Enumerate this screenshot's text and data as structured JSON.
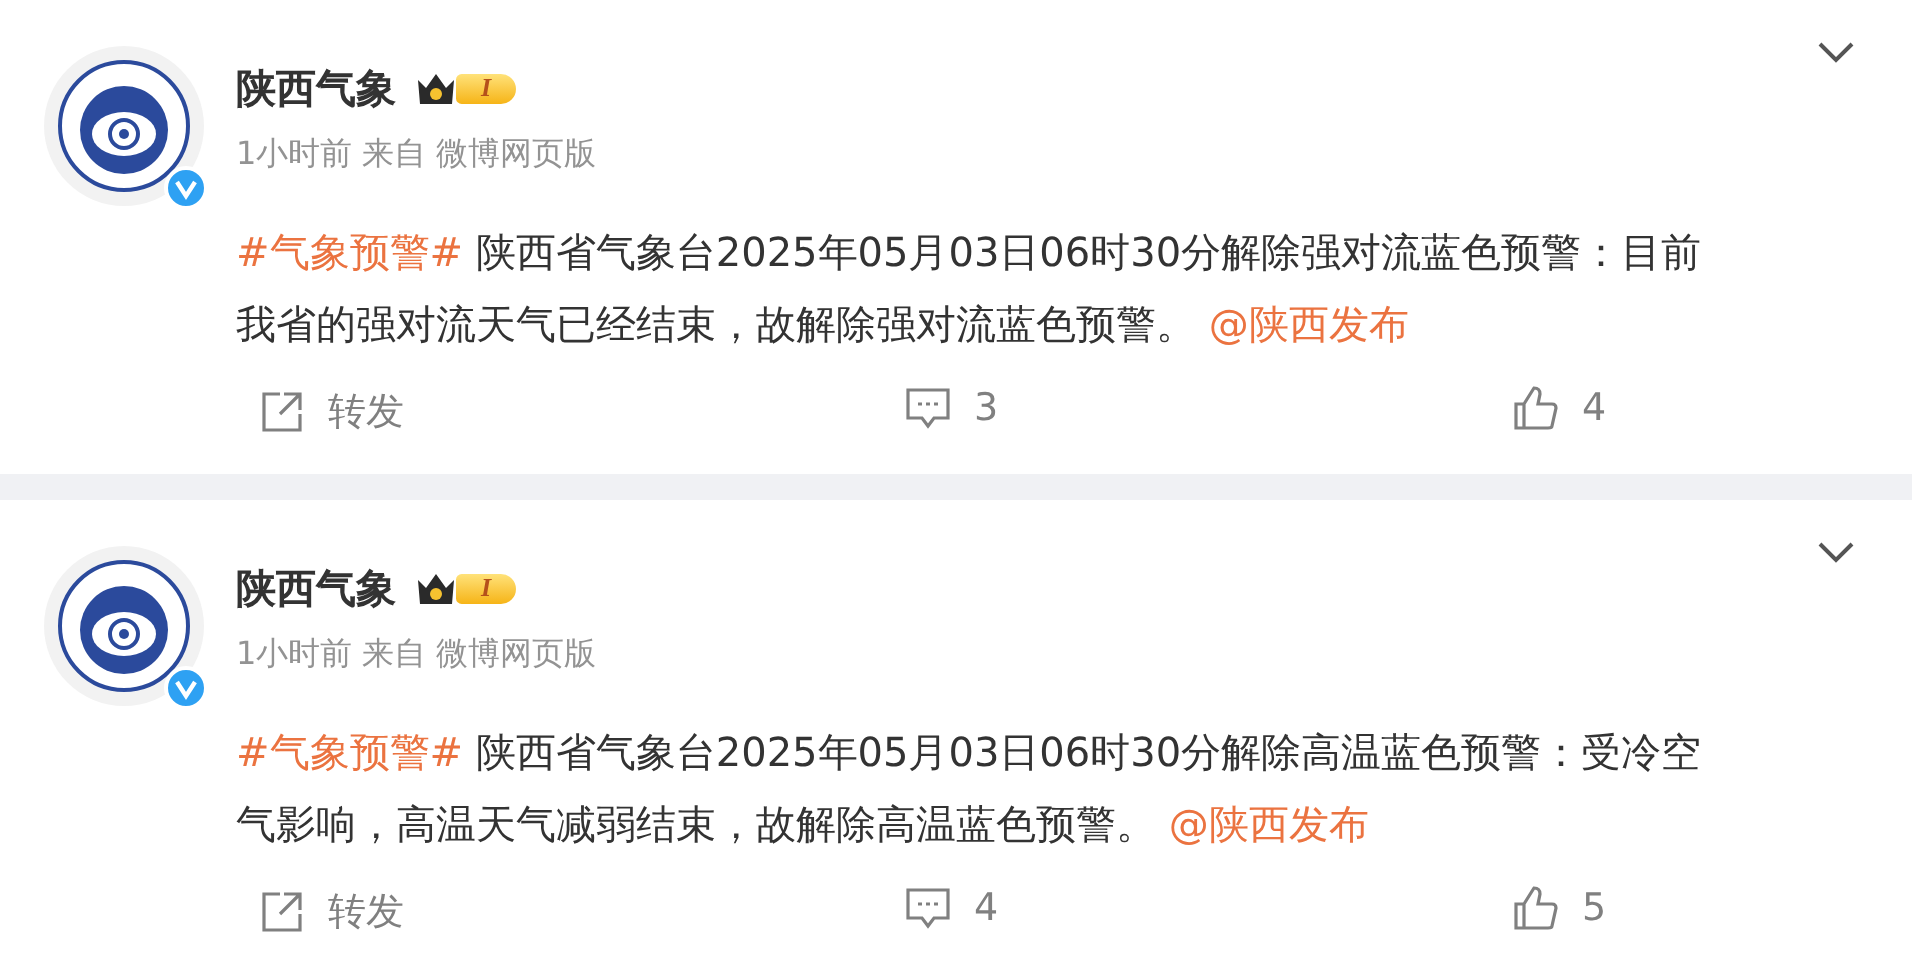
{
  "posts": [
    {
      "author": "陕西气象",
      "level_badge": "I",
      "verified": true,
      "time": "1小时前",
      "source_prefix": "来自",
      "source": "微博网页版",
      "content": [
        {
          "kind": "topic",
          "text": "#气象预警#"
        },
        {
          "kind": "text",
          "text": " 陕西省气象台2025年05月03日06时30分解除强对流蓝色预警：目前我省的强对流天气已经结束，故解除强对流蓝色预警。 "
        },
        {
          "kind": "mention",
          "text": "@陕西发布"
        }
      ],
      "actions": [
        {
          "kind": "repost",
          "label": "转发"
        },
        {
          "kind": "comment",
          "label": "3"
        },
        {
          "kind": "like",
          "label": "4"
        }
      ]
    },
    {
      "author": "陕西气象",
      "level_badge": "I",
      "verified": true,
      "time": "1小时前",
      "source_prefix": "来自",
      "source": "微博网页版",
      "content": [
        {
          "kind": "topic",
          "text": "#气象预警#"
        },
        {
          "kind": "text",
          "text": " 陕西省气象台2025年05月03日06时30分解除高温蓝色预警：受冷空气影响，高温天气减弱结束，故解除高温蓝色预警。 "
        },
        {
          "kind": "mention",
          "text": "@陕西发布"
        }
      ],
      "actions": [
        {
          "kind": "repost",
          "label": "转发"
        },
        {
          "kind": "comment",
          "label": "4"
        },
        {
          "kind": "like",
          "label": "5"
        }
      ]
    }
  ]
}
